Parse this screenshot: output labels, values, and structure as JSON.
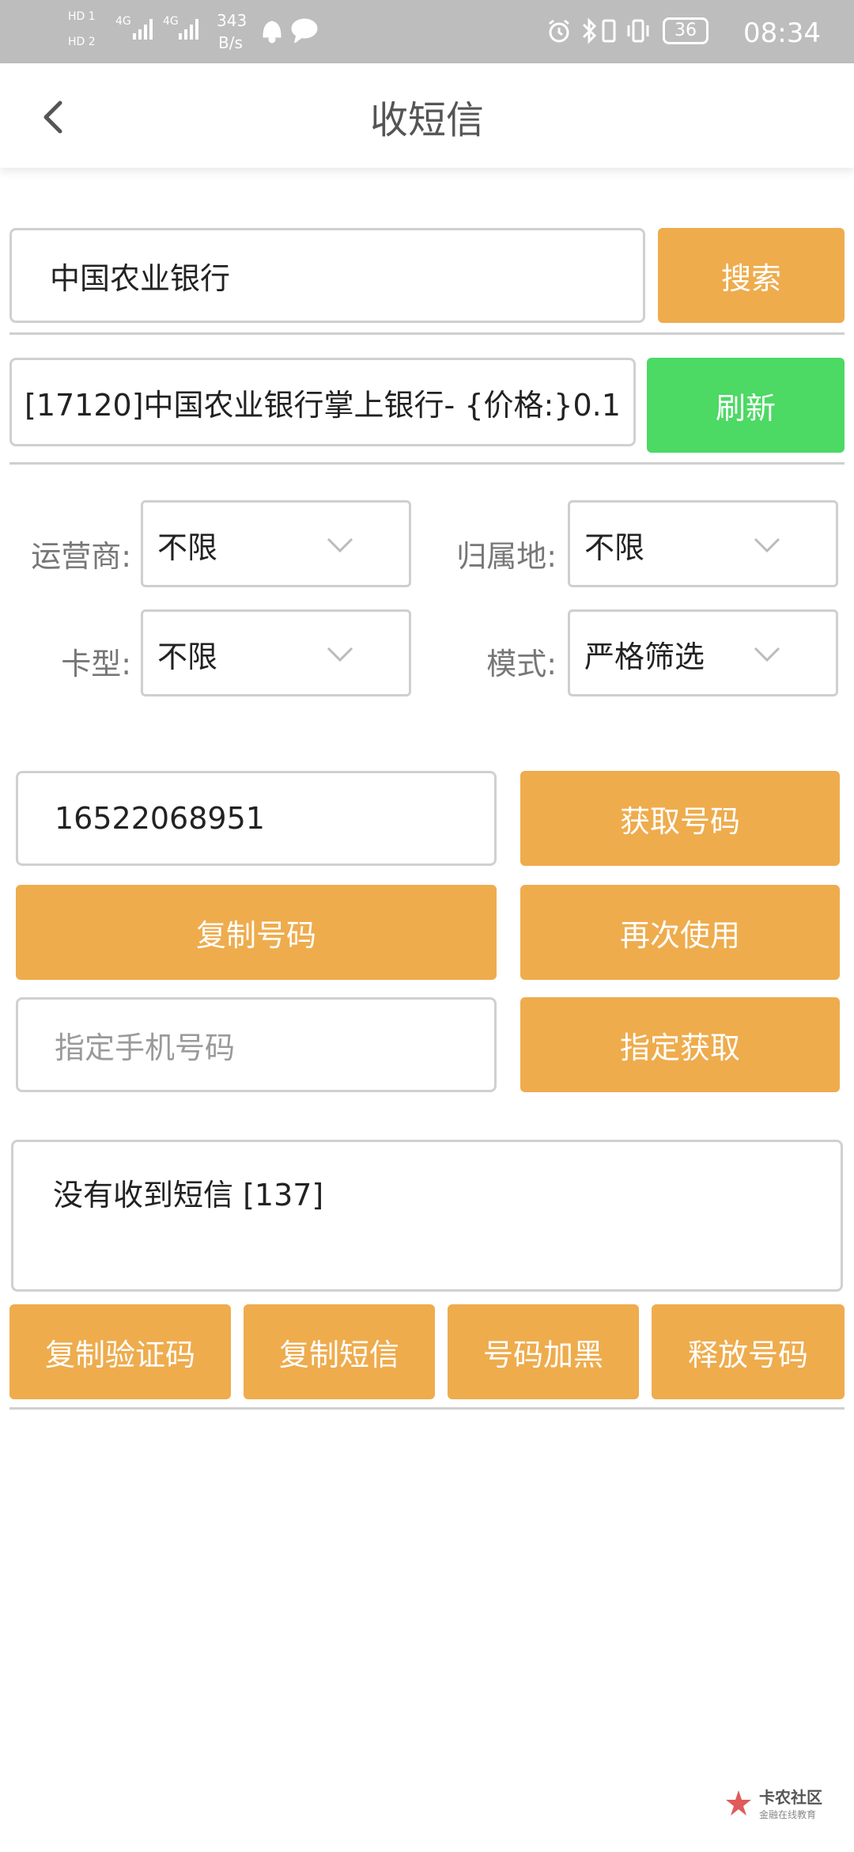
{
  "status": {
    "hd1": "HD 1",
    "hd2": "HD 2",
    "net1": "4G",
    "net2": "4G",
    "speed_value": "343",
    "speed_unit": "B/s",
    "battery": "36",
    "time": "08:34"
  },
  "header": {
    "title": "收短信"
  },
  "search": {
    "value": "中国农业银行",
    "button": "搜索"
  },
  "project": {
    "value": "[17120]中国农业银行掌上银行- {价格:}0.1",
    "button": "刷新"
  },
  "filters": {
    "carrier_label": "运营商:",
    "carrier_value": "不限",
    "region_label": "归属地:",
    "region_value": "不限",
    "cardtype_label": "卡型:",
    "cardtype_value": "不限",
    "mode_label": "模式:",
    "mode_value": "严格筛选"
  },
  "number": {
    "value": "16522068951",
    "get_button": "获取号码",
    "copy_button": "复制号码",
    "reuse_button": "再次使用",
    "specify_placeholder": "指定手机号码",
    "specify_button": "指定获取"
  },
  "sms": {
    "message": "没有收到短信 [137]"
  },
  "actions": {
    "copy_code": "复制验证码",
    "copy_sms": "复制短信",
    "blacklist": "号码加黑",
    "release": "释放号码"
  },
  "watermark": {
    "text": "卡农社区",
    "sub": "金融在线教育"
  },
  "colors": {
    "orange": "#eeac4d",
    "green": "#4cd964",
    "statusbar": "#bdbdbd"
  }
}
